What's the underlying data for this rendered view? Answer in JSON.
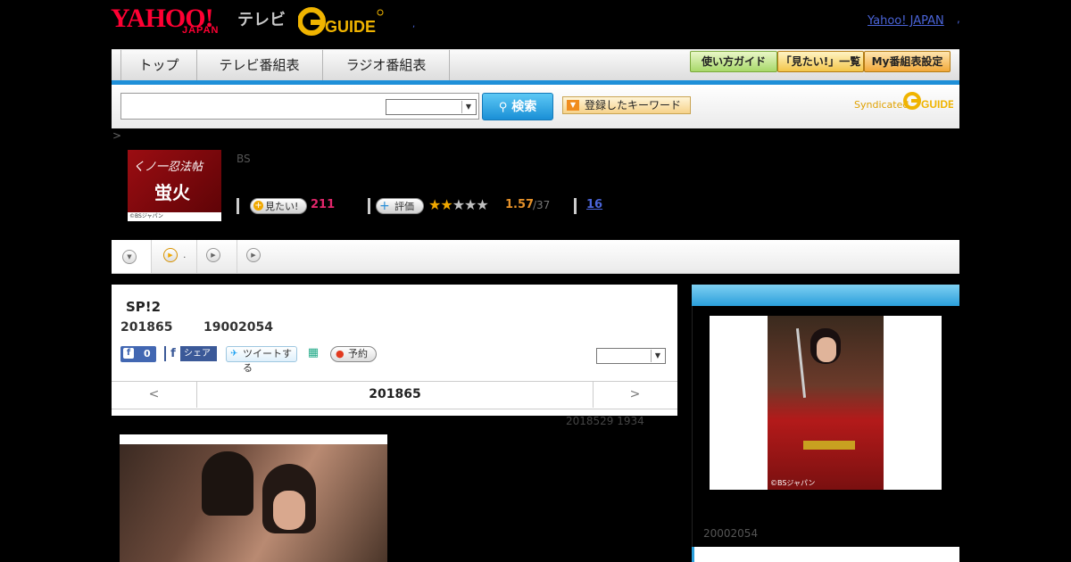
{
  "header": {
    "logo_yahoo": "YAHOO!",
    "logo_japan": "JAPAN",
    "logo_tv": "テレビ",
    "logo_gguide": "G-GUIDE",
    "yahoo_japan_link": "Yahoo! JAPAN",
    "link_sep": ","
  },
  "nav": {
    "tabs": [
      {
        "label": "トップ"
      },
      {
        "label": "テレビ番組表"
      },
      {
        "label": "ラジオ番組表"
      }
    ],
    "buttons": [
      {
        "label": "使い方ガイド"
      },
      {
        "label": "「見たい!」一覧"
      },
      {
        "label": "My番組表設定"
      }
    ]
  },
  "search": {
    "placeholder": "",
    "button_label": "検索",
    "keyword_button_label": "登録したキーワード",
    "syndicated_label": "Syndicated"
  },
  "breadcrumb": ">",
  "program": {
    "thumb_title_line1": "くノ一忍法帖",
    "thumb_title_line2": "蛍火",
    "thumb_credit": "©BSジャパン",
    "channel": "BS",
    "want_label": "見たい!",
    "want_count": "211",
    "rate_label": "評価",
    "stars_filled": "★★",
    "stars_empty": "★★★",
    "rating_value": 1.57,
    "rating_value_text": "1.57",
    "rating_count": "/37",
    "review_count": "16",
    "title": "SP!2",
    "date": "201865",
    "time": "19002054",
    "fb_like_count": "0",
    "fb_share_label": "シェア",
    "tweet_label": "ツイートする",
    "reserve_label": "予約",
    "date_nav": {
      "prev": "<",
      "current": "201865",
      "next": ">"
    },
    "updated": "2018529  1934"
  },
  "subtabs": {
    "tab2_label": "."
  },
  "right_panel": {
    "credit": "©BSジャパン",
    "time": "20002054"
  },
  "colors": {
    "accent_blue": "#1e8fd8",
    "want_pink": "#e2266b",
    "rating_orange": "#e5912a",
    "link_blue": "#4a64d8"
  }
}
